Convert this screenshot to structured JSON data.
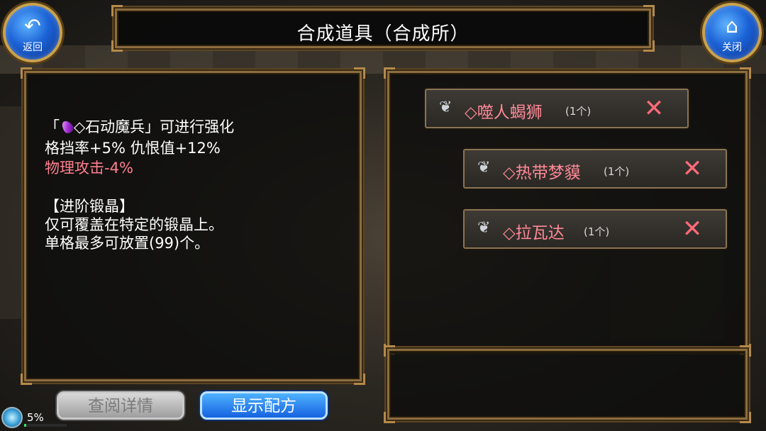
{
  "title": "合成道具（合成所）",
  "nav": {
    "back_label": "返回",
    "close_label": "关闭"
  },
  "info": {
    "line1_prefix": "「",
    "line1_item": "◇石动魔兵」可进行强化",
    "line2": "格挡率+5% 仇恨值+12%",
    "line3": "物理攻击-4%",
    "line4": "【进阶锻晶】",
    "line5": "仅可覆盖在特定的锻晶上。",
    "line6": "单格最多可放置(99)个。"
  },
  "items": [
    {
      "name": "◇噬人蝎狮",
      "qty": "(1个)"
    },
    {
      "name": "◇热带梦貘",
      "qty": "(1个)"
    },
    {
      "name": "◇拉瓦达",
      "qty": "(1个)"
    }
  ],
  "buttons": {
    "view_details": "查阅详情",
    "show_recipe": "显示配方"
  },
  "status": {
    "percent_label": "5%",
    "progress": 0.05
  },
  "colors": {
    "accent_red": "#ff8896",
    "button_blue": "#1662e0",
    "frame_gold": "#8c6d3f"
  }
}
